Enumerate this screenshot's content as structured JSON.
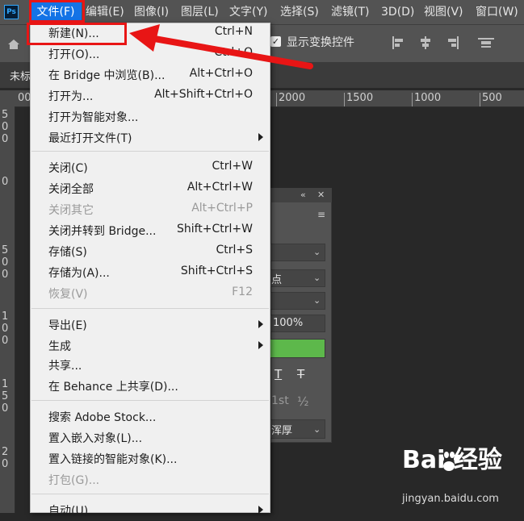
{
  "app": {
    "logo_text": "Ps"
  },
  "menubar": {
    "items": [
      "文件(F)",
      "编辑(E)",
      "图像(I)",
      "图层(L)",
      "文字(Y)",
      "选择(S)",
      "滤镜(T)",
      "3D(D)",
      "视图(V)",
      "窗口(W)"
    ]
  },
  "options_bar": {
    "show_transform_label": "显示变换控件",
    "checked_mark": "✓"
  },
  "doc_tab": {
    "label": "未标"
  },
  "ruler": {
    "h_labels": [
      "00",
      "2000",
      "1500",
      "1000",
      "500"
    ],
    "v_labels": [
      "5",
      "0",
      "0",
      "0",
      "5",
      "0",
      "0",
      "1",
      "0",
      "0",
      "1",
      "5",
      "0",
      "2",
      "0"
    ]
  },
  "char_panel": {
    "collapse_icon": "«",
    "close_icon": "✕",
    "menu_icon": "≡",
    "field_point": "点",
    "field_scale": "100%",
    "color_swatch": "#5db84b",
    "glyph_t1": "T",
    "glyph_t2": "T",
    "glyph_st": "1st",
    "glyph_half": "½",
    "field_antialias": "浑厚"
  },
  "file_menu": {
    "items": [
      {
        "label": "新建(N)...",
        "shortcut": "Ctrl+N",
        "disabled": false,
        "submenu": false
      },
      {
        "label": "打开(O)...",
        "shortcut": "Ctrl+O",
        "disabled": false,
        "submenu": false
      },
      {
        "label": "在 Bridge 中浏览(B)...",
        "shortcut": "Alt+Ctrl+O",
        "disabled": false,
        "submenu": false
      },
      {
        "label": "打开为...",
        "shortcut": "Alt+Shift+Ctrl+O",
        "disabled": false,
        "submenu": false
      },
      {
        "label": "打开为智能对象...",
        "shortcut": "",
        "disabled": false,
        "submenu": false
      },
      {
        "label": "最近打开文件(T)",
        "shortcut": "",
        "disabled": false,
        "submenu": true
      },
      {
        "label": "关闭(C)",
        "shortcut": "Ctrl+W",
        "disabled": false,
        "submenu": false
      },
      {
        "label": "关闭全部",
        "shortcut": "Alt+Ctrl+W",
        "disabled": false,
        "submenu": false
      },
      {
        "label": "关闭其它",
        "shortcut": "Alt+Ctrl+P",
        "disabled": true,
        "submenu": false
      },
      {
        "label": "关闭并转到 Bridge...",
        "shortcut": "Shift+Ctrl+W",
        "disabled": false,
        "submenu": false
      },
      {
        "label": "存储(S)",
        "shortcut": "Ctrl+S",
        "disabled": false,
        "submenu": false
      },
      {
        "label": "存储为(A)...",
        "shortcut": "Shift+Ctrl+S",
        "disabled": false,
        "submenu": false
      },
      {
        "label": "恢复(V)",
        "shortcut": "F12",
        "disabled": true,
        "submenu": false
      },
      {
        "label": "导出(E)",
        "shortcut": "",
        "disabled": false,
        "submenu": true
      },
      {
        "label": "生成",
        "shortcut": "",
        "disabled": false,
        "submenu": true
      },
      {
        "label": "共享...",
        "shortcut": "",
        "disabled": false,
        "submenu": false
      },
      {
        "label": "在 Behance 上共享(D)...",
        "shortcut": "",
        "disabled": false,
        "submenu": false
      },
      {
        "label": "搜索 Adobe Stock...",
        "shortcut": "",
        "disabled": false,
        "submenu": false
      },
      {
        "label": "置入嵌入对象(L)...",
        "shortcut": "",
        "disabled": false,
        "submenu": false
      },
      {
        "label": "置入链接的智能对象(K)...",
        "shortcut": "",
        "disabled": false,
        "submenu": false
      },
      {
        "label": "打包(G)...",
        "shortcut": "",
        "disabled": true,
        "submenu": false
      },
      {
        "label": "自动(U)",
        "shortcut": "",
        "disabled": false,
        "submenu": true
      }
    ]
  },
  "annotation": {
    "color": "#e81515"
  },
  "watermark": {
    "brand": "Bai  经验",
    "url": "jingyan.baidu.com"
  }
}
